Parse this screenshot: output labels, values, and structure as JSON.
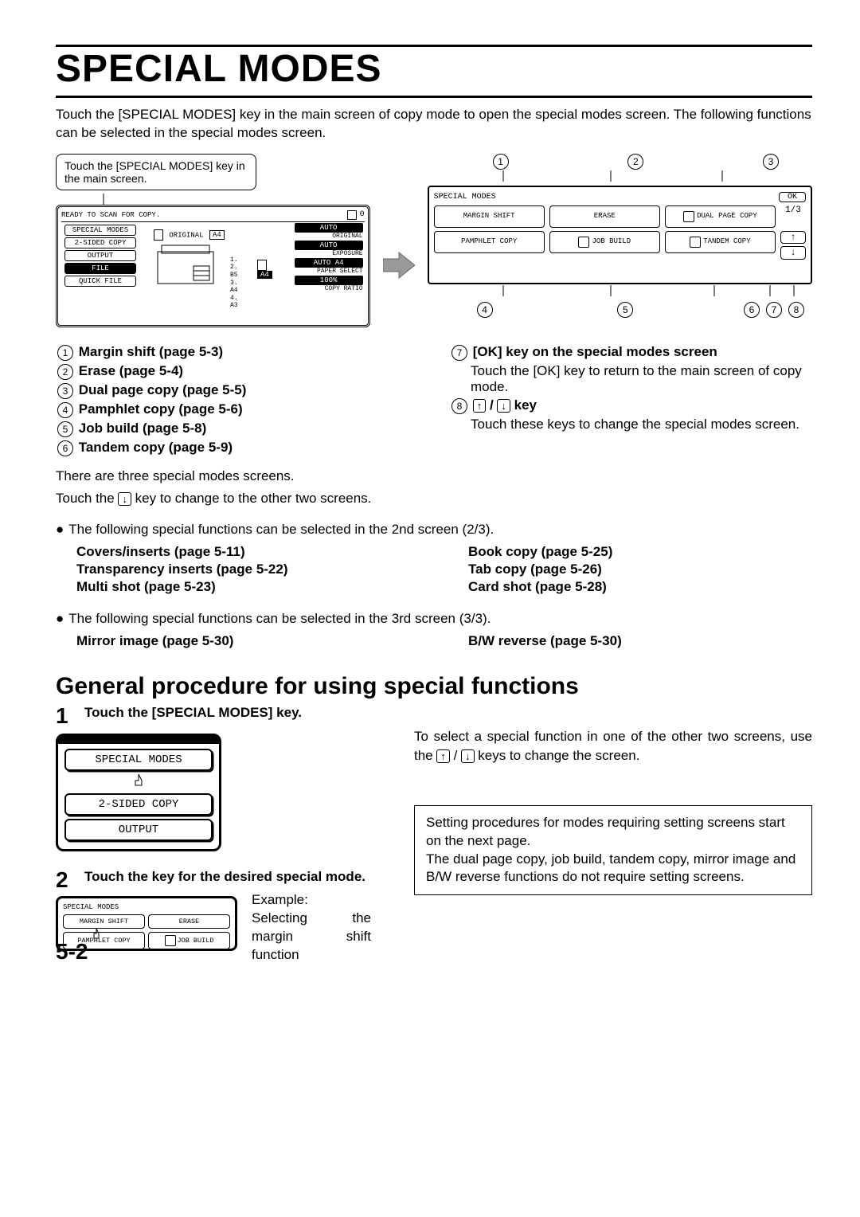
{
  "title": "SPECIAL MODES",
  "intro": "Touch the [SPECIAL MODES] key in the main screen of copy mode to open the special modes screen. The following functions can be selected in the special modes screen.",
  "callout": "Touch the [SPECIAL MODES] key in the main screen.",
  "main_screen": {
    "tab": "READY TO SCAN FOR COPY.",
    "counter": "0",
    "side_buttons": [
      "SPECIAL MODES",
      "2-SIDED COPY",
      "OUTPUT",
      "FILE",
      "QUICK FILE"
    ],
    "original_label": "ORIGINAL",
    "original_size": "A4",
    "settings": [
      {
        "value": "AUTO",
        "label": "ORIGINAL"
      },
      {
        "value": "AUTO",
        "label": "EXPOSURE"
      },
      {
        "value": "AUTO  A4",
        "label": "PAPER SELECT"
      },
      {
        "value": "100%",
        "label": "COPY RATIO"
      }
    ],
    "trays": [
      "1.",
      "2. B5",
      "3. A4",
      "4. A3"
    ],
    "tray_right": "A4"
  },
  "sm_panel": {
    "title": "SPECIAL MODES",
    "ok": "OK",
    "page_ind": "1/3",
    "up": "↑",
    "down": "↓",
    "buttons": [
      "MARGIN SHIFT",
      "ERASE",
      "DUAL PAGE COPY",
      "PAMPHLET COPY",
      "JOB BUILD",
      "TANDEM COPY"
    ]
  },
  "markers_top": [
    "1",
    "2",
    "3"
  ],
  "markers_bot": [
    "4",
    "5",
    "6",
    "7",
    "8"
  ],
  "key_list_left": [
    "Margin shift (page 5-3)",
    "Erase (page 5-4)",
    "Dual page copy (page 5-5)",
    "Pamphlet copy (page 5-6)",
    "Job build (page 5-8)",
    "Tandem copy (page 5-9)"
  ],
  "key_list_right_7_title": "[OK] key on the special modes screen",
  "key_list_right_7_body": "Touch the [OK] key to return to the main screen of copy mode.",
  "key_list_right_8_title_pre": "",
  "key_list_right_8_keylabel": " key",
  "key_list_right_8_body": "Touch these keys to change the special modes screen.",
  "three_screens_line1": "There are three special modes screens.",
  "three_screens_line2_a": "Touch the ",
  "three_screens_line2_b": " key to change to the other two screens.",
  "screen2_intro": "The following special functions can be selected in the 2nd screen (2/3).",
  "screen2_left": [
    "Covers/inserts (page 5-11)",
    "Transparency inserts (page 5-22)",
    "Multi shot (page 5-23)"
  ],
  "screen2_right": [
    "Book copy (page 5-25)",
    "Tab copy (page 5-26)",
    "Card shot (page 5-28)"
  ],
  "screen3_intro": "The following special functions can be selected in the 3rd screen (3/3).",
  "screen3_left": [
    "Mirror image (page 5-30)"
  ],
  "screen3_right": [
    "B/W reverse (page 5-30)"
  ],
  "subheading": "General procedure for using special functions",
  "step1_title": "Touch the [SPECIAL MODES] key.",
  "keypad": [
    "SPECIAL MODES",
    "2-SIDED COPY",
    "OUTPUT"
  ],
  "step1_right_a": "To select a special function in one of the other two screens, use the ",
  "step1_right_b": " keys to change the screen.",
  "boxnote_l1": "Setting procedures for modes requiring setting screens start on the next page.",
  "boxnote_l2": "The dual page copy, job build, tandem copy, mirror image and B/W reverse functions do not require setting screens.",
  "step2_title": "Touch the key for the desired special mode.",
  "step2_example_l1": "Example:",
  "step2_example_l2": "Selecting the margin shift function",
  "mini_panel": {
    "title": "SPECIAL MODES",
    "buttons": [
      "MARGIN SHIFT",
      "ERASE",
      "PAMPHLET COPY",
      "JOB BUILD"
    ]
  },
  "page_no": "5-2"
}
